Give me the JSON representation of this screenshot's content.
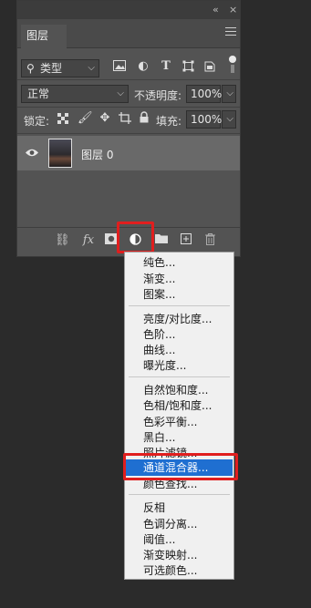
{
  "panel": {
    "title_icons": {
      "collapse": "«",
      "close": "×"
    },
    "tab_label": "图层",
    "filter": {
      "label": "类型"
    },
    "blend_mode": {
      "value": "正常"
    },
    "opacity": {
      "label": "不透明度:",
      "value": "100%"
    },
    "lock": {
      "label": "锁定:"
    },
    "fill": {
      "label": "填充:",
      "value": "100%"
    },
    "layer": {
      "name": "图层 0"
    }
  },
  "context_menu": {
    "group1": [
      "纯色...",
      "渐变...",
      "图案..."
    ],
    "group2": [
      "亮度/对比度...",
      "色阶...",
      "曲线...",
      "曝光度..."
    ],
    "group3": [
      "自然饱和度...",
      "色相/饱和度...",
      "色彩平衡...",
      "黑白...",
      "照片滤镜...",
      "通道混合器...",
      "颜色查找..."
    ],
    "group4": [
      "反相",
      "色调分离...",
      "阈值...",
      "渐变映射...",
      "可选颜色..."
    ],
    "selected": "通道混合器..."
  },
  "colors": {
    "highlight": "#e01e1e",
    "selection": "#1f6fd1",
    "panel": "#535353"
  }
}
